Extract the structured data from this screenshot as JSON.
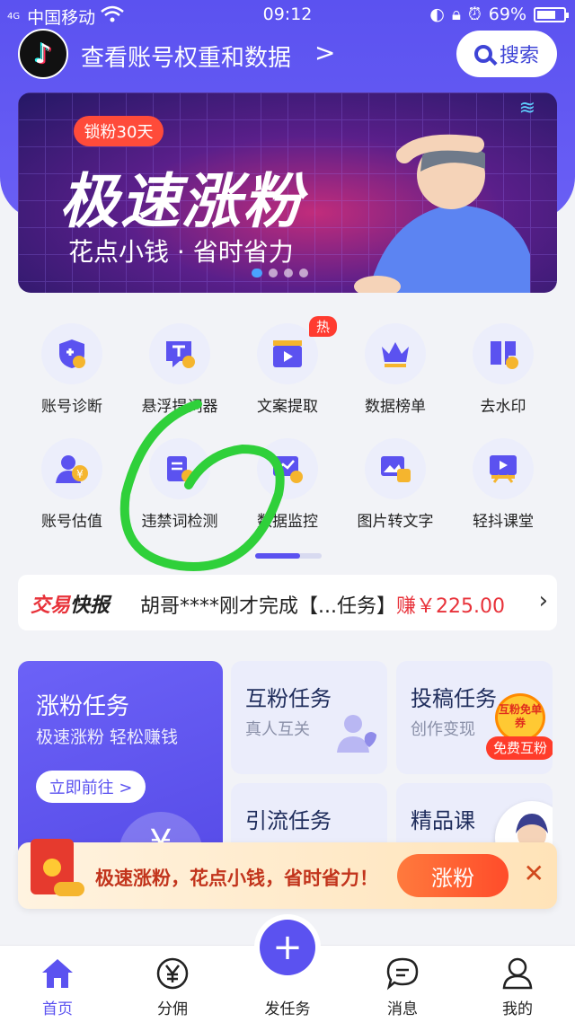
{
  "status_bar": {
    "signal": "4G",
    "carrier": "中国移动",
    "time": "09:12",
    "battery": "69%"
  },
  "header": {
    "title": "查看账号权重和数据",
    "chevron": ">",
    "search_label": "搜索"
  },
  "banner": {
    "badge": "锁粉30天",
    "headline": "极速涨粉",
    "subtitle": "花点小钱 · 省时省力",
    "slide_index": 1,
    "slide_count": 4
  },
  "tools": [
    {
      "label": "账号诊断",
      "icon": "shield-user-icon"
    },
    {
      "label": "悬浮提词器",
      "icon": "teleprompter-icon"
    },
    {
      "label": "文案提取",
      "icon": "video-icon",
      "tag": "热"
    },
    {
      "label": "数据榜单",
      "icon": "crown-icon"
    },
    {
      "label": "去水印",
      "icon": "stamp-icon"
    },
    {
      "label": "账号估值",
      "icon": "user-yen-icon"
    },
    {
      "label": "违禁词检测",
      "icon": "forbidden-word-icon"
    },
    {
      "label": "数据监控",
      "icon": "monitor-icon"
    },
    {
      "label": "图片转文字",
      "icon": "image-text-icon"
    },
    {
      "label": "轻抖课堂",
      "icon": "classroom-icon"
    }
  ],
  "news": {
    "tag_a": "交易",
    "tag_b": "快报",
    "text": "胡哥****刚才完成【...任务】",
    "money": "赚￥225.00"
  },
  "tasks": {
    "main": {
      "title": "涨粉任务",
      "subtitle": "极速涨粉 轻松赚钱",
      "button": "立即前往 >",
      "coin": "¥"
    },
    "mutual": {
      "title": "互粉任务",
      "subtitle": "真人互关"
    },
    "submit": {
      "title": "投稿任务",
      "subtitle": "创作变现",
      "badge_top": "互粉免单券",
      "badge_bottom": "免费互粉"
    },
    "traffic": {
      "title": "引流任务"
    },
    "course": {
      "title": "精品课"
    }
  },
  "promo": {
    "text": "极速涨粉，花点小钱，省时省力！",
    "button": "涨粉",
    "close": "✕"
  },
  "tabbar": [
    {
      "label": "首页",
      "icon": "home-icon",
      "active": true
    },
    {
      "label": "分佣",
      "icon": "yen-circle-icon"
    },
    {
      "label": "发任务",
      "icon": "plus-icon"
    },
    {
      "label": "消息",
      "icon": "message-icon"
    },
    {
      "label": "我的",
      "icon": "user-icon"
    }
  ],
  "colors": {
    "primary": "#5b52f0",
    "accent_red": "#e8323a",
    "annotation_green": "#2fd03a"
  }
}
